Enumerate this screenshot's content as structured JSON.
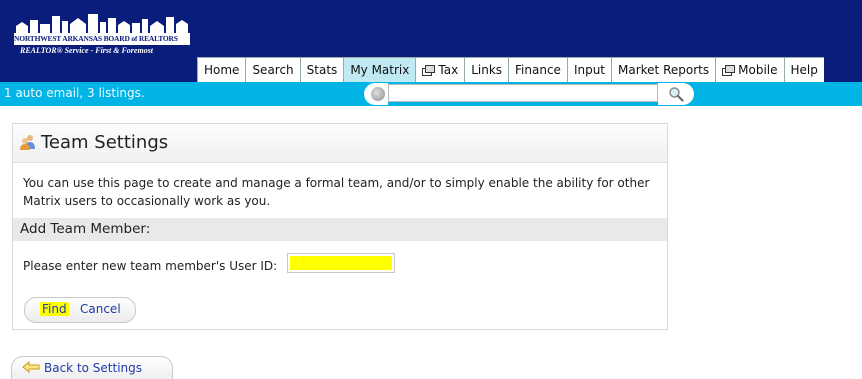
{
  "header": {
    "logo_line1": "NORTHWEST ARKANSAS BOARD of REALTORS",
    "logo_line2": "REALTOR® Service - First & Foremost",
    "nav": [
      {
        "label": "Home",
        "icon": ""
      },
      {
        "label": "Search",
        "icon": ""
      },
      {
        "label": "Stats",
        "icon": ""
      },
      {
        "label": "My Matrix",
        "icon": "",
        "active": true
      },
      {
        "label": "Tax",
        "icon": "popup-window-icon"
      },
      {
        "label": "Links",
        "icon": ""
      },
      {
        "label": "Finance",
        "icon": ""
      },
      {
        "label": "Input",
        "icon": ""
      },
      {
        "label": "Market Reports",
        "icon": ""
      },
      {
        "label": "Mobile",
        "icon": "popup-window-icon"
      },
      {
        "label": "Help",
        "icon": ""
      }
    ]
  },
  "statusbar": {
    "text": "1 auto email, 3 listings.",
    "search_value": "",
    "search_placeholder": ""
  },
  "panel": {
    "title": "Team Settings",
    "description": "You can use this page to create and manage a formal team, and/or to simply enable the ability for other Matrix users to occasionally work as you.",
    "section_title": "Add Team Member:",
    "userid_label": "Please enter new team member's User ID:",
    "userid_value": "",
    "find_label": "Find",
    "cancel_label": "Cancel"
  },
  "back_button": {
    "label": "Back to Settings"
  },
  "colors": {
    "header_bg": "#0a1d7a",
    "status_bg": "#00b4e6",
    "active_tab": "#bfeaf4",
    "highlight": "#ffff00",
    "link": "#1e3aa8"
  }
}
